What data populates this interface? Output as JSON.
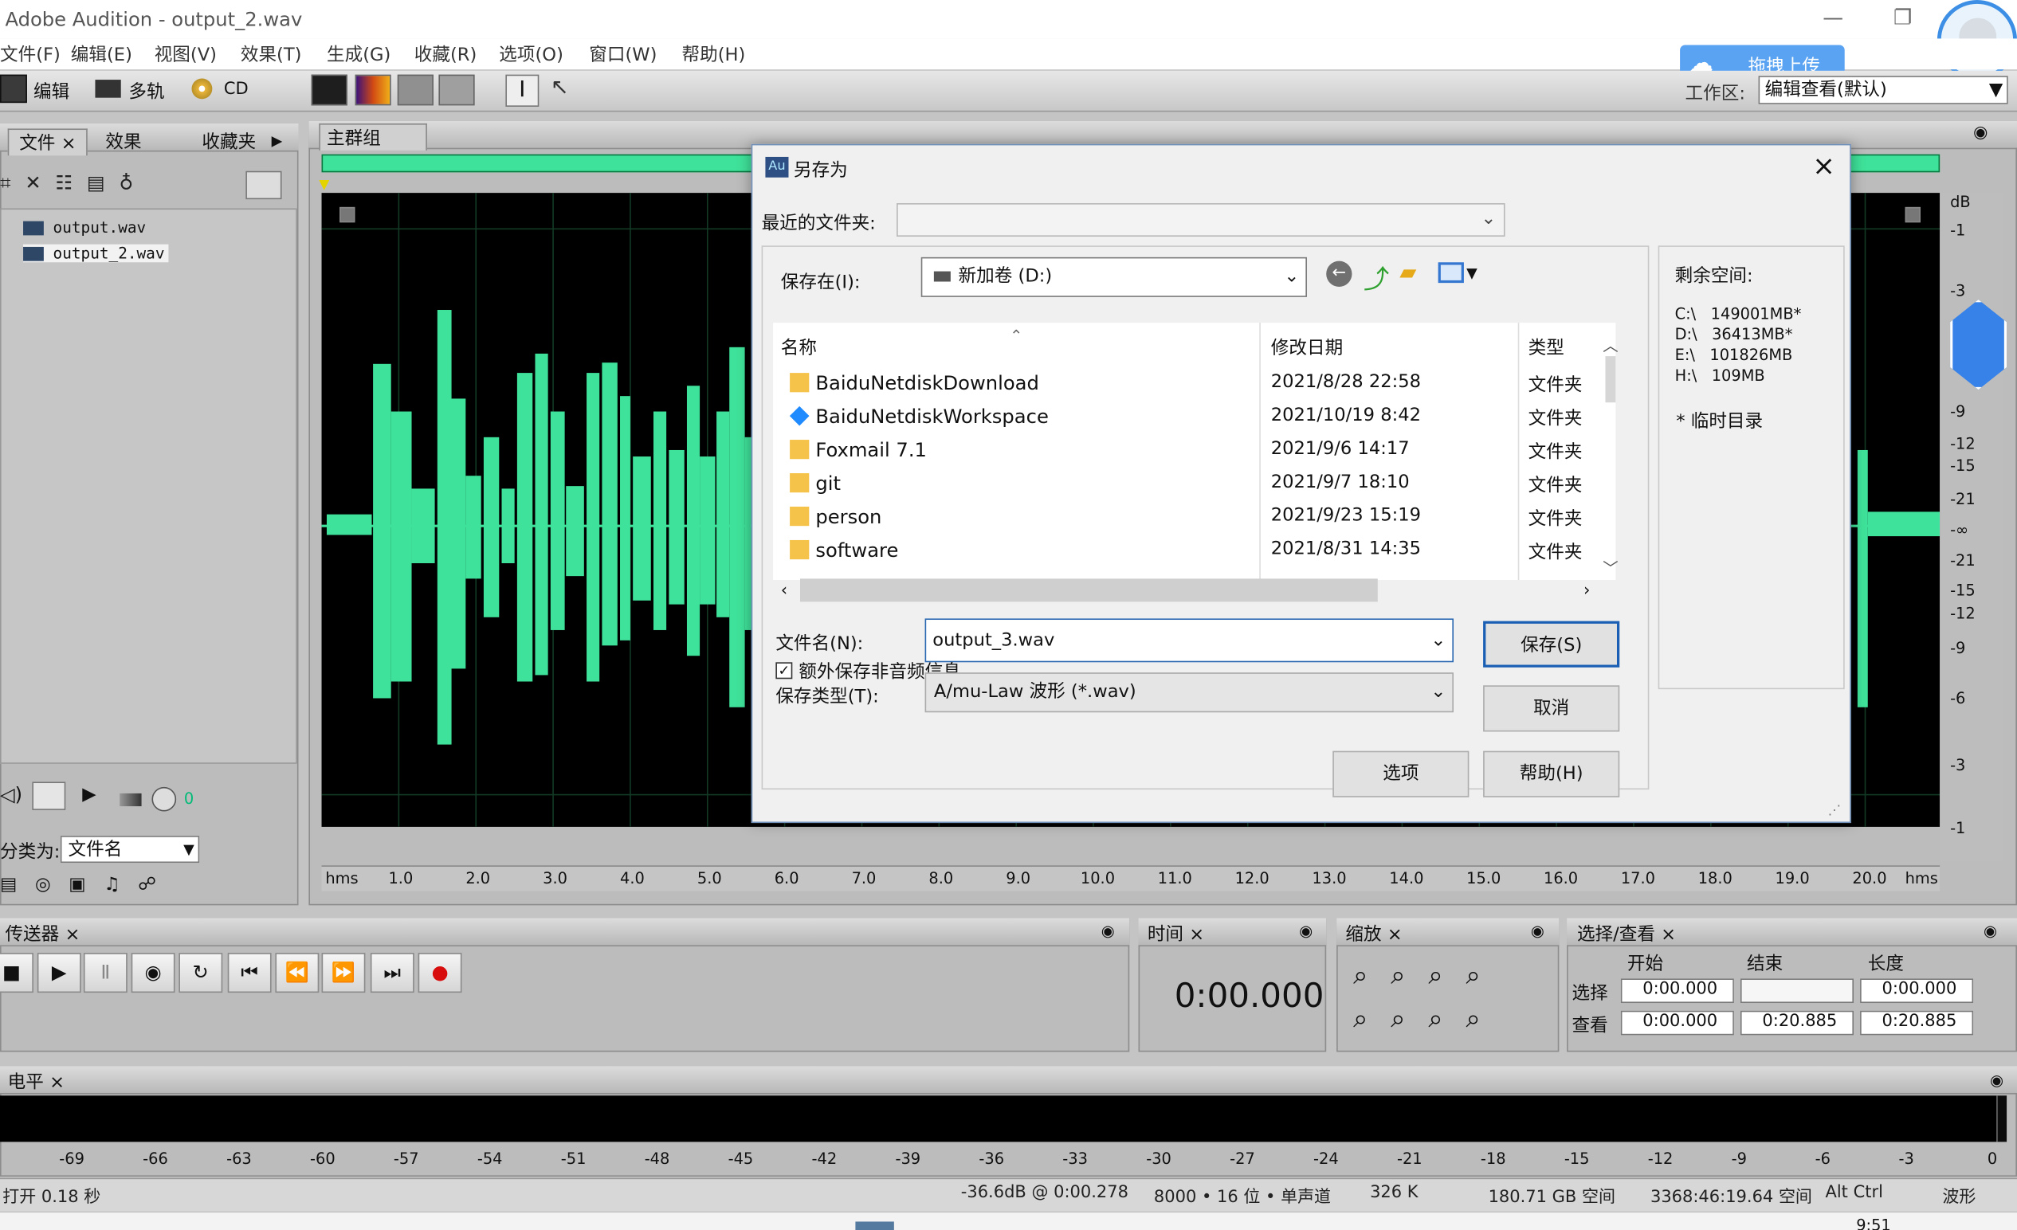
{
  "window": {
    "title": "Adobe Audition - output_2.wav",
    "minimize": "—",
    "maximize": "❐"
  },
  "menu": [
    "文件(F)",
    "编辑(E)",
    "视图(V)",
    "效果(T)",
    "生成(G)",
    "收藏(R)",
    "选项(O)",
    "窗口(W)",
    "帮助(H)"
  ],
  "toolbar": {
    "edit": "编辑",
    "multitrack": "多轨",
    "cd": "CD",
    "workspace_label": "工作区:",
    "workspace_value": "编辑查看(默认)",
    "upload": "拖拽上传"
  },
  "left_panel": {
    "tabs": [
      "文件",
      "效果",
      "收藏夹"
    ],
    "files": [
      "output.wav",
      "output_2.wav"
    ],
    "sort_label": "分类为:",
    "sort_value": "文件名",
    "volume_value": "0"
  },
  "main_group": {
    "title": "主群组",
    "ticks": [
      "hms",
      "1.0",
      "2.0",
      "3.0",
      "4.0",
      "5.0",
      "6.0",
      "7.0",
      "8.0",
      "9.0",
      "10.0",
      "11.0",
      "12.0",
      "13.0",
      "14.0",
      "15.0",
      "16.0",
      "17.0",
      "18.0",
      "19.0",
      "20.0",
      "hms"
    ],
    "db_scale": [
      "dB",
      "-1",
      "-3",
      "-6",
      "-9",
      "-12",
      "-15",
      "-21",
      "-∞",
      "-21",
      "-15",
      "-12",
      "-9",
      "-6",
      "-3",
      "-1"
    ]
  },
  "dialog": {
    "title": "另存为",
    "recent_label": "最近的文件夹:",
    "save_in_label": "保存在(I):",
    "save_in_value": "新加卷 (D:)",
    "columns": [
      "名称",
      "修改日期",
      "类型"
    ],
    "rows": [
      {
        "name": "BaiduNetdiskDownload",
        "date": "2021/8/28 22:58",
        "type": "文件夹"
      },
      {
        "name": "BaiduNetdiskWorkspace",
        "date": "2021/10/19 8:42",
        "type": "文件夹"
      },
      {
        "name": "Foxmail 7.1",
        "date": "2021/9/6 14:17",
        "type": "文件夹"
      },
      {
        "name": "git",
        "date": "2021/9/7 18:10",
        "type": "文件夹"
      },
      {
        "name": "person",
        "date": "2021/9/23 15:19",
        "type": "文件夹"
      },
      {
        "name": "software",
        "date": "2021/8/31 14:35",
        "type": "文件夹"
      }
    ],
    "filename_label": "文件名(N):",
    "filename_value": "output_3.wav",
    "extra_checkbox": "额外保存非音频信息",
    "filetype_label": "保存类型(T):",
    "filetype_value": "A/mu-Law 波形 (*.wav)",
    "save_button": "保存(S)",
    "cancel_button": "取消",
    "options_button": "选项",
    "help_button": "帮助(H)",
    "space_title": "剩余空间:",
    "space": [
      "C:\\   149001MB*",
      "D:\\   36413MB*",
      "E:\\   101826MB",
      "H:\\   109MB"
    ],
    "temp_note": "* 临时目录"
  },
  "transport": {
    "title": "传送器",
    "buttons": [
      "■",
      "▶",
      "Ⅱ",
      "◉",
      "↻",
      "⏮",
      "⏪",
      "⏩",
      "⏭",
      "●"
    ]
  },
  "time": {
    "title": "时间",
    "value": "0:00.000"
  },
  "zoom": {
    "title": "缩放"
  },
  "selection": {
    "title": "选择/查看",
    "headers": [
      "开始",
      "结束",
      "长度"
    ],
    "select_label": "选择",
    "view_label": "查看",
    "select": [
      "0:00.000",
      "",
      "0:00.000"
    ],
    "view": [
      "0:00.000",
      "0:20.885",
      "0:20.885"
    ]
  },
  "level": {
    "title": "电平",
    "ticks": [
      "-69",
      "-66",
      "-63",
      "-60",
      "-57",
      "-54",
      "-51",
      "-48",
      "-45",
      "-42",
      "-39",
      "-36",
      "-33",
      "-30",
      "-27",
      "-24",
      "-21",
      "-18",
      "-15",
      "-12",
      "-9",
      "-6",
      "-3",
      "0"
    ]
  },
  "status": [
    "打开 0.18 秒",
    "-36.6dB @  0:00.278",
    "8000 • 16 位 • 单声道",
    "326 K",
    "180.71 GB 空间",
    "3368:46:19.64 空间",
    "Alt Ctrl",
    "波形"
  ],
  "clock": "9:51",
  "colors": {
    "wave": "#3fe29a",
    "accent": "#3d8fe5",
    "dialog_border": "#6f8fb8"
  }
}
